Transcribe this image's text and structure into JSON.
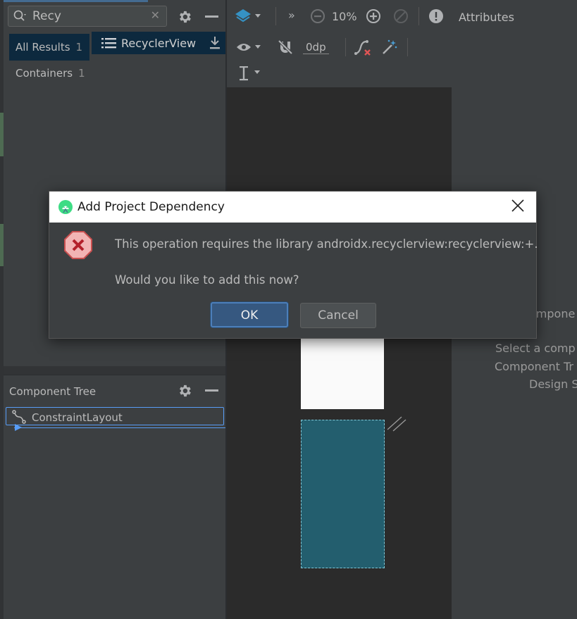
{
  "palette": {
    "search_value": "Recy",
    "categories": [
      {
        "label": "All Results",
        "count": "1"
      },
      {
        "label": "Containers",
        "count": "1"
      }
    ],
    "result_item": "RecyclerView"
  },
  "toolbar": {
    "zoom": "10%",
    "margin": "0dp"
  },
  "component_tree": {
    "title": "Component Tree",
    "root": "ConstraintLayout"
  },
  "attributes": {
    "title": "Attributes",
    "hint_line1": "ompone",
    "hint_line2": "Select a comp",
    "hint_line3": "Component Tr",
    "hint_line4": "Design S"
  },
  "dialog": {
    "title": "Add Project Dependency",
    "message": "This operation requires the library androidx.recyclerview:recyclerview:+.",
    "question": "Would you like to add this now?",
    "ok_label": "OK",
    "cancel_label": "Cancel"
  },
  "colors": {
    "accent": "#4a88c7",
    "selection": "#0d293e",
    "blueprint": "#235e6e",
    "error": "#e06c75"
  }
}
